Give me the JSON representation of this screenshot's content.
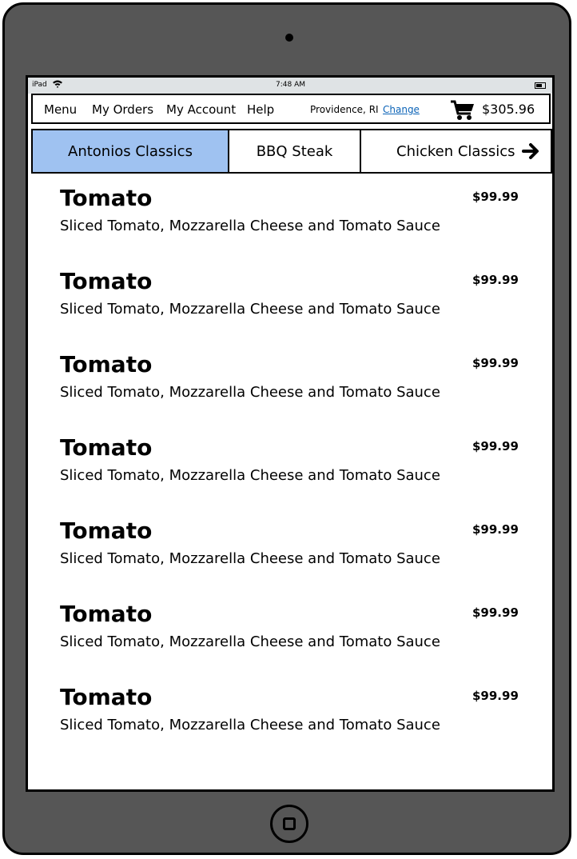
{
  "status": {
    "carrier": "iPad",
    "time": "7:48 AM"
  },
  "nav": {
    "menu": "Menu",
    "orders": "My Orders",
    "account": "My Account",
    "help": "Help",
    "location": "Providence, RI",
    "change": "Change",
    "cart_total": "$305.96"
  },
  "tabs": [
    {
      "label": "Antonios Classics",
      "active": true
    },
    {
      "label": "BBQ Steak",
      "active": false
    },
    {
      "label": "Chicken Classics",
      "active": false
    }
  ],
  "items": [
    {
      "name": "Tomato",
      "description": "Sliced Tomato, Mozzarella Cheese and Tomato Sauce",
      "price": "$99.99"
    },
    {
      "name": "Tomato",
      "description": "Sliced Tomato, Mozzarella Cheese and Tomato Sauce",
      "price": "$99.99"
    },
    {
      "name": "Tomato",
      "description": "Sliced Tomato, Mozzarella Cheese and Tomato Sauce",
      "price": "$99.99"
    },
    {
      "name": "Tomato",
      "description": "Sliced Tomato, Mozzarella Cheese and Tomato Sauce",
      "price": "$99.99"
    },
    {
      "name": "Tomato",
      "description": "Sliced Tomato, Mozzarella Cheese and Tomato Sauce",
      "price": "$99.99"
    },
    {
      "name": "Tomato",
      "description": "Sliced Tomato, Mozzarella Cheese and Tomato Sauce",
      "price": "$99.99"
    },
    {
      "name": "Tomato",
      "description": "Sliced Tomato, Mozzarella Cheese and Tomato Sauce",
      "price": "$99.99"
    }
  ],
  "colors": {
    "device": "#565656",
    "active_tab": "#9fc2f1",
    "link": "#0b63b7",
    "statusbar": "#dfe3e5"
  },
  "icons": {
    "cart": "shopping-cart-icon",
    "next": "arrow-right-icon",
    "wifi": "wifi-icon",
    "battery": "battery-icon"
  }
}
